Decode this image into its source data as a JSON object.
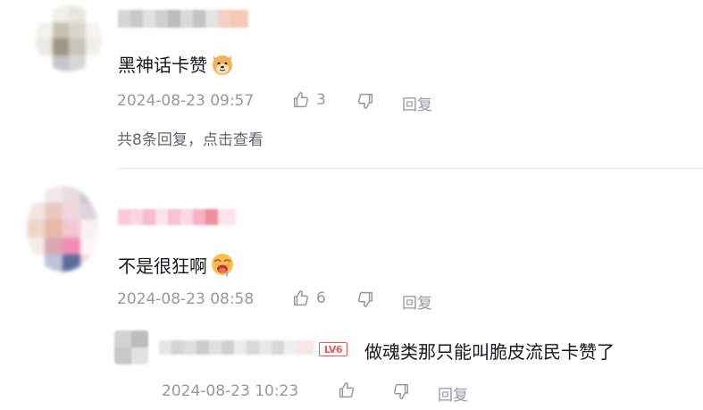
{
  "comments": [
    {
      "text": "黑神话卡赞",
      "emoji": "doge-emoji",
      "time": "2024-08-23 09:57",
      "likes": "3",
      "reply_label": "回复",
      "view_replies": "共8条回复，点击查看"
    },
    {
      "text": "不是很狂啊",
      "emoji": "drooling-emoji",
      "time": "2024-08-23 08:58",
      "likes": "6",
      "reply_label": "回复"
    }
  ],
  "reply": {
    "level": "LV6",
    "text": "做魂类那只能叫脆皮流民卡赞了",
    "time": "2024-08-23 10:23",
    "reply_label": "回复"
  },
  "colors": {
    "meta_gray": "#9499a0",
    "text": "#18191c",
    "divider": "#e3e5e7",
    "level_red": "#ee5a5a"
  }
}
